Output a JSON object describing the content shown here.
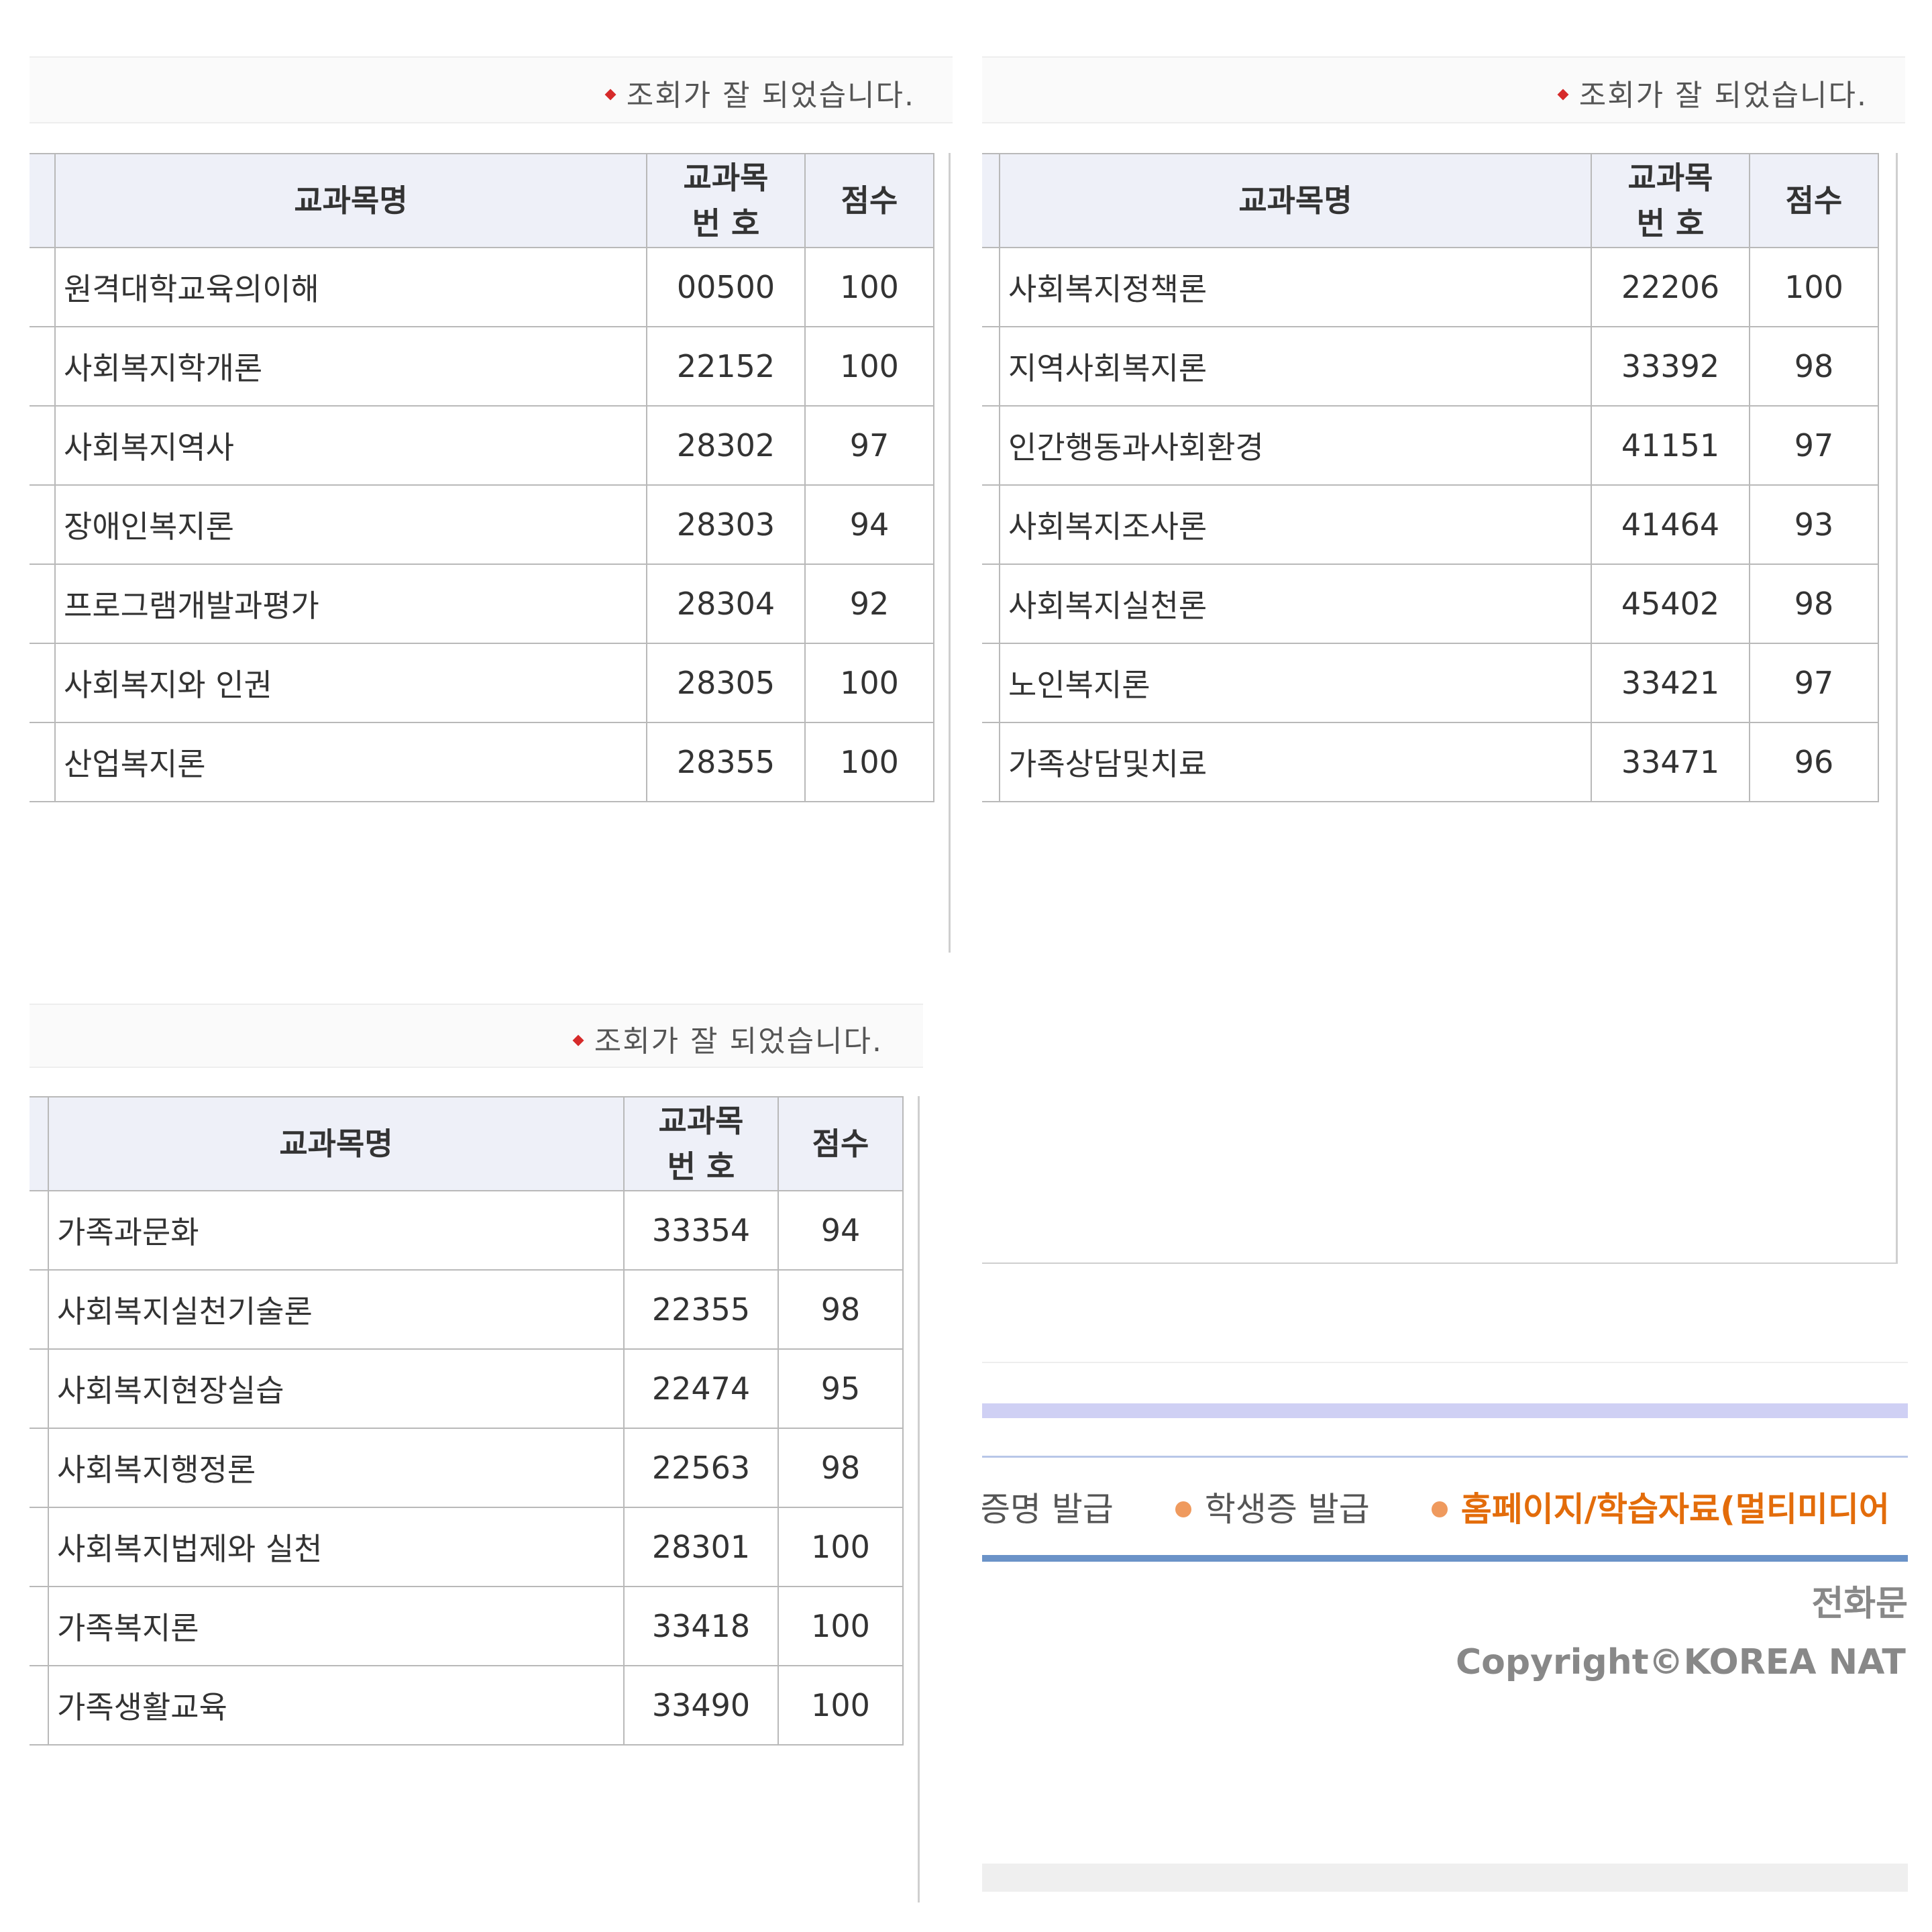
{
  "status_message": "조회가 잘 되었습니다.",
  "table_headers": {
    "course_name": "교과목명",
    "course_code_line1": "교과목",
    "course_code_line2": "번 호",
    "score": "점수"
  },
  "panels": [
    {
      "rows": [
        {
          "name": "원격대학교육의이해",
          "code": "00500",
          "score": "100"
        },
        {
          "name": "사회복지학개론",
          "code": "22152",
          "score": "100"
        },
        {
          "name": "사회복지역사",
          "code": "28302",
          "score": "97"
        },
        {
          "name": "장애인복지론",
          "code": "28303",
          "score": "94"
        },
        {
          "name": "프로그램개발과평가",
          "code": "28304",
          "score": "92"
        },
        {
          "name": "사회복지와 인권",
          "code": "28305",
          "score": "100"
        },
        {
          "name": "산업복지론",
          "code": "28355",
          "score": "100"
        }
      ]
    },
    {
      "rows": [
        {
          "name": "사회복지정책론",
          "code": "22206",
          "score": "100"
        },
        {
          "name": "지역사회복지론",
          "code": "33392",
          "score": "98"
        },
        {
          "name": "인간행동과사회환경",
          "code": "41151",
          "score": "97"
        },
        {
          "name": "사회복지조사론",
          "code": "41464",
          "score": "93"
        },
        {
          "name": "사회복지실천론",
          "code": "45402",
          "score": "98"
        },
        {
          "name": "노인복지론",
          "code": "33421",
          "score": "97"
        },
        {
          "name": "가족상담및치료",
          "code": "33471",
          "score": "96"
        }
      ]
    },
    {
      "rows": [
        {
          "name": "가족과문화",
          "code": "33354",
          "score": "94"
        },
        {
          "name": "사회복지실천기술론",
          "code": "22355",
          "score": "98"
        },
        {
          "name": "사회복지현장실습",
          "code": "22474",
          "score": "95"
        },
        {
          "name": "사회복지행정론",
          "code": "22563",
          "score": "98"
        },
        {
          "name": "사회복지법제와 실천",
          "code": "28301",
          "score": "100"
        },
        {
          "name": "가족복지론",
          "code": "33418",
          "score": "100"
        },
        {
          "name": "가족생활교육",
          "code": "33490",
          "score": "100"
        }
      ]
    }
  ],
  "footer": {
    "nav_items": [
      "! 증명 발급",
      "학생증 발급",
      "홈페이지/학습자료(멀티미디어"
    ],
    "phone_label": "전화문",
    "copyright": "Copyright©KOREA NATIOI"
  }
}
